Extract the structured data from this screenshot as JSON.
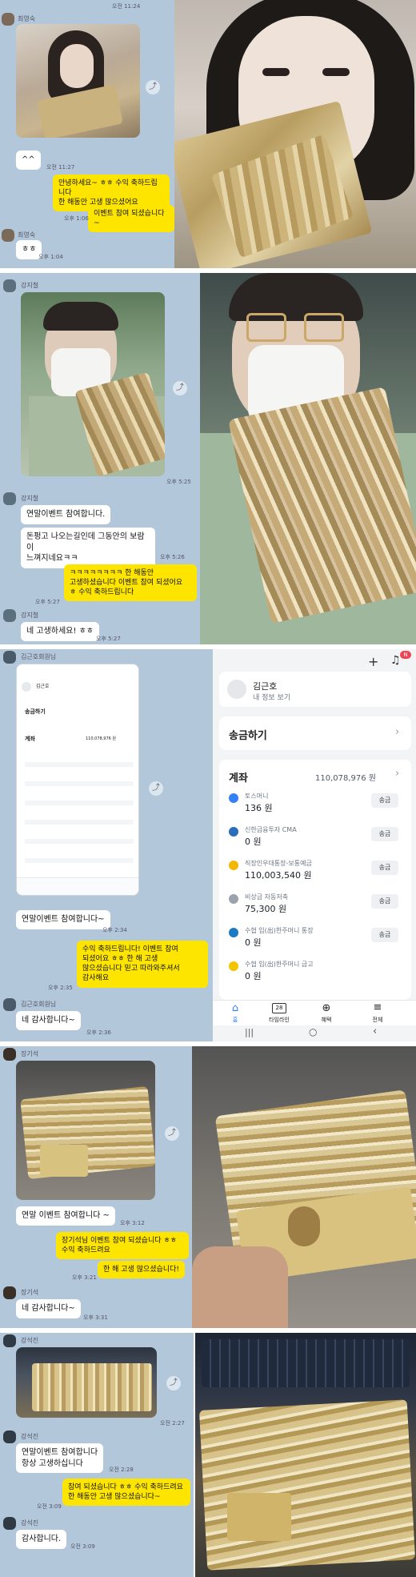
{
  "panels": [
    {
      "top_time": "오전 11:24",
      "sender": "최영숙",
      "bubble_emoticon": "^^",
      "time_after_emoticon": "오전 11:27",
      "yellow": "안녕하세요~ ㅎㅎ 수익 축하드립니다\n한 해동안 고생 많으셨어요",
      "yellow2": "이벤트 참여 되셨습니다~",
      "yellow2_time": "오후 1:06",
      "sender2": "최영숙",
      "bubble_end": "ㅎㅎ",
      "bubble_end_time": "오후 1:04"
    },
    {
      "sender": "강지철",
      "thumb_time": "오후 5:25",
      "sender2": "강지철",
      "msg1": "연말이벤트 참여합니다.",
      "msg2": "돈펑고 나오는길인데 그동안의 보람이\n느껴지네요ㅋㅋ",
      "msg2_time": "오후 5:26",
      "yellow": "ㅋㅋㅋㅋㅋㅋㅋㅋ 한 해동안\n고생하셨습니다 이벤트 참여 되셨어요\nㅎ 수익 축하드립니다",
      "yellow_time": "오후 5:27",
      "sender3": "강지철",
      "msg3": "네 고생하세요! ㅎㅎ",
      "msg3_time": "오후 5:27"
    },
    {
      "sender": "김근호회원님",
      "msg1": "연말이벤트 참여합니다~",
      "msg1_time": "오후 2:34",
      "yellow": "수익 축하드립니다! 이벤트 참여\n되셨어요 ㅎㅎ 한 해 고생\n많으셨습니다 믿고 따라와주셔서\n감사해요",
      "yellow_time": "오후 2:35",
      "sender2": "김근호회원님",
      "msg2": "네 감사합니다~",
      "msg2_time": "오후 2:36",
      "bank": {
        "user_name": "김근호",
        "profile_link": "내 정보 보기",
        "badge": "N",
        "transfer": "송금하기",
        "accounts_title": "계좌",
        "accounts_total": "110,078,976 원",
        "accounts": [
          {
            "name": "토스머니",
            "amount": "136 원",
            "action": "송금",
            "color": "#3182f6"
          },
          {
            "name": "신한금융투자 CMA",
            "amount": "0 원",
            "action": "송금",
            "color": "#2a6ebb"
          },
          {
            "name": "직장인우대통장-보통예금",
            "amount": "110,003,540 원",
            "action": "송금",
            "color": "#f5b800"
          },
          {
            "name": "비상금 자동저축",
            "amount": "75,300 원",
            "action": "송금",
            "color": "#9aa3ad"
          },
          {
            "name": "수협 입(出)한주머니 통장",
            "amount": "0 원",
            "action": "송금",
            "color": "#1a7bc4"
          },
          {
            "name": "수협 입(出)한주머니 금고",
            "amount": "0 원",
            "action": "",
            "color": "#f5c400"
          }
        ],
        "nav": [
          "홈",
          "타임라인",
          "혜택",
          "전체"
        ],
        "nav_date": "28"
      }
    },
    {
      "sender": "장기석",
      "msg1": "연말 이벤트 참여합니다 ~",
      "msg1_time": "오후 3:12",
      "yellow": "장기석님 이벤트 참여 되셨습니다 ㅎㅎ\n수익 축하드려요",
      "yellow2": "한 해 고생 많으셨습니다!",
      "yellow2_time": "오후 3:21",
      "sender2": "장기석",
      "msg2": "네 감사합니다~",
      "msg2_time": "오후 3:31"
    },
    {
      "sender": "강석진",
      "thumb_time": "오전 2:27",
      "sender2": "강석진",
      "msg1": "연말이벤트 참여합니다\n항상 고생하십니다",
      "msg1_time": "오전 2:28",
      "yellow": "참여 되셨습니다 ㅎㅎ 수익 축하드려요\n한 해동안 고생 많으셨습니다~",
      "yellow_time": "오전 3:09",
      "sender3": "강석진",
      "msg2": "감사합니다.",
      "msg2_time": "오전 3:09"
    }
  ],
  "icons": {
    "share": "share-icon",
    "bell": "bell-icon",
    "plus": "plus-icon"
  },
  "colors": {
    "chat_bg": "#b2c7d9",
    "yellow_bubble": "#fee500",
    "toss_blue": "#3182f6"
  }
}
